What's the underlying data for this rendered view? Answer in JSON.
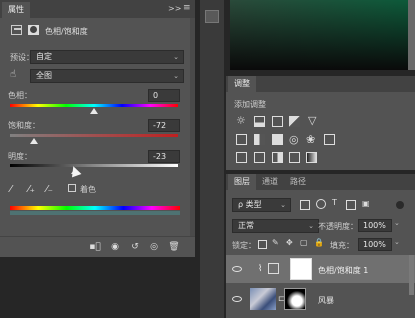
{
  "properties_panel": {
    "tab_label": "属性",
    "collapse_glyph": ">>",
    "menu_glyph": "≡",
    "title": "色相/饱和度",
    "preset_label": "预设：",
    "preset_value": "自定",
    "channel_value": "全图",
    "hue_label": "色相：",
    "hue_value": "0",
    "saturation_label": "饱和度：",
    "saturation_value": "-72",
    "lightness_label": "明度：",
    "lightness_value": "-23",
    "colorize_label": "着色",
    "hue_level": 0.5,
    "saturation_level": 0.14,
    "lightness_level": 0.385
  },
  "adjustments_panel": {
    "tab_label": "调整",
    "add_label": "添加调整"
  },
  "layers_panel": {
    "tabs": [
      "图层",
      "通道",
      "路径"
    ],
    "filter_value": "ρ 类型",
    "blend_value": "正常",
    "opacity_label": "不透明度：",
    "opacity_value": "100%",
    "lock_label": "锁定：",
    "fill_label": "填充：",
    "fill_value": "100%",
    "layers": [
      {
        "name": "色相/饱和度 1",
        "selected": true
      },
      {
        "name": "风暴",
        "selected": false
      }
    ]
  },
  "colors": {
    "panel": "#535353",
    "dark": "#262626",
    "selected_row": "#707070",
    "accent_blue": "#4a7fd0"
  }
}
